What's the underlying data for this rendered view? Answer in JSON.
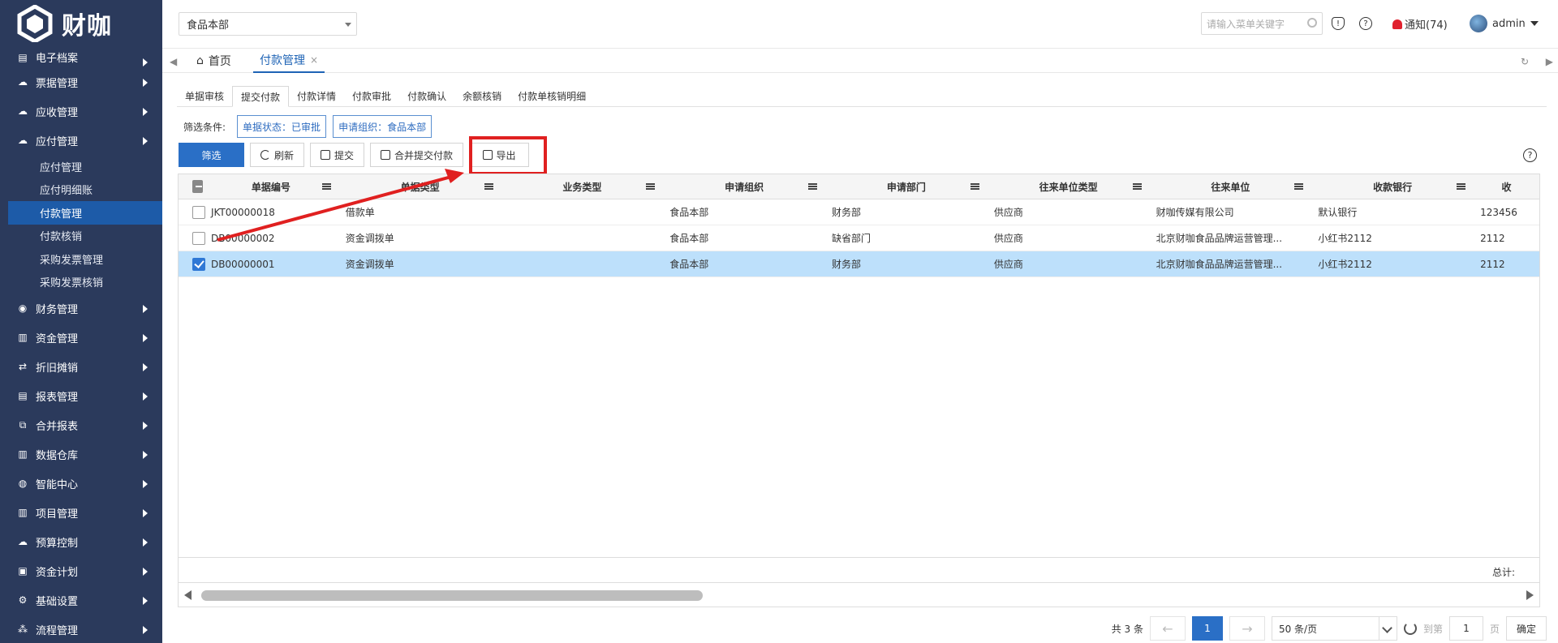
{
  "app": {
    "brand": "财咖"
  },
  "sidebar": {
    "items_top": [
      {
        "label": "电子档案",
        "icon": "archive-icon"
      },
      {
        "label": "票据管理",
        "icon": "cloud-icon"
      },
      {
        "label": "应收管理",
        "icon": "cloud-icon"
      },
      {
        "label": "应付管理",
        "icon": "cloud-icon"
      }
    ],
    "sub_items": [
      {
        "label": "应付管理"
      },
      {
        "label": "应付明细账"
      },
      {
        "label": "付款管理"
      },
      {
        "label": "付款核销"
      },
      {
        "label": "采购发票管理"
      },
      {
        "label": "采购发票核销"
      }
    ],
    "items_bottom": [
      {
        "label": "财务管理",
        "icon": "finance-icon"
      },
      {
        "label": "资金管理",
        "icon": "bar-chart-icon"
      },
      {
        "label": "折旧摊销",
        "icon": "repeat-icon"
      },
      {
        "label": "报表管理",
        "icon": "report-icon"
      },
      {
        "label": "合并报表",
        "icon": "merge-icon"
      },
      {
        "label": "数据仓库",
        "icon": "bar-chart-icon"
      },
      {
        "label": "智能中心",
        "icon": "globe-icon"
      },
      {
        "label": "项目管理",
        "icon": "bar-chart-icon"
      },
      {
        "label": "预算控制",
        "icon": "cloud-icon"
      },
      {
        "label": "资金计划",
        "icon": "plan-icon"
      },
      {
        "label": "基础设置",
        "icon": "gear-icon"
      },
      {
        "label": "流程管理",
        "icon": "flow-icon"
      }
    ]
  },
  "header": {
    "org": "食品本部",
    "search_placeholder": "请输入菜单关键字",
    "notify": "通知(74)",
    "user": "admin"
  },
  "tabs": {
    "home": "首页",
    "active": "付款管理",
    "close": "×"
  },
  "subtabs": [
    "单据审核",
    "提交付款",
    "付款详情",
    "付款审批",
    "付款确认",
    "余额核销",
    "付款单核销明细"
  ],
  "filters": {
    "label": "筛选条件:",
    "chips": [
      "单据状态：已审批",
      "申请组织：食品本部"
    ]
  },
  "toolbar": {
    "filter": "筛选",
    "refresh": "刷新",
    "submit": "提交",
    "merge_submit": "合并提交付款",
    "export": "导出"
  },
  "grid": {
    "columns": [
      "单据编号",
      "单据类型",
      "业务类型",
      "申请组织",
      "申请部门",
      "往来单位类型",
      "往来单位",
      "收款银行",
      "收"
    ],
    "rows": [
      {
        "selected": false,
        "cells": [
          "JKT00000018",
          "借款单",
          "",
          "食品本部",
          "财务部",
          "供应商",
          "财咖传媒有限公司",
          "默认银行",
          "123456"
        ]
      },
      {
        "selected": false,
        "cells": [
          "DB00000002",
          "资金调拨单",
          "",
          "食品本部",
          "缺省部门",
          "供应商",
          "北京财咖食品品牌运营管理...",
          "小红书2112",
          "2112"
        ]
      },
      {
        "selected": true,
        "cells": [
          "DB00000001",
          "资金调拨单",
          "",
          "食品本部",
          "财务部",
          "供应商",
          "北京财咖食品品牌运营管理...",
          "小红书2112",
          "2112"
        ]
      }
    ],
    "total_label": "总计:"
  },
  "pager": {
    "total": "共 3 条",
    "prev": "←",
    "page": "1",
    "next": "→",
    "size": "50 条/页",
    "goto": "到第",
    "goto_value": "1",
    "page_unit": "页",
    "confirm": "确定"
  },
  "colors": {
    "sidebar": "#2b3a5c",
    "accent": "#2a6fc6",
    "highlight": "#e02020",
    "selected_row": "#bde0fb"
  }
}
